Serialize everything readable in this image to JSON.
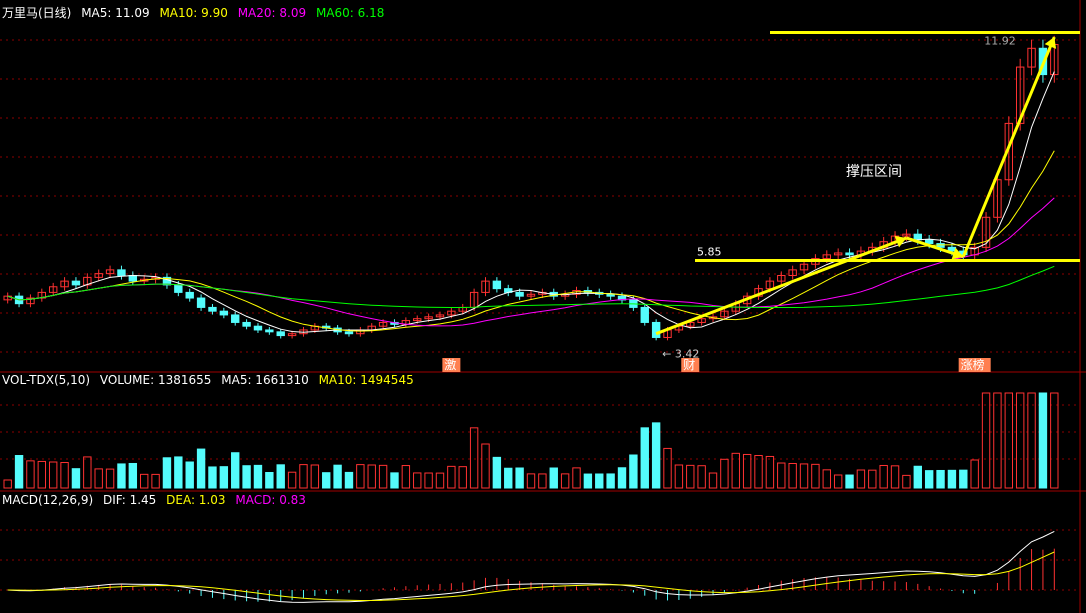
{
  "header": {
    "title": "万里马(日线)",
    "ma_labels": [
      {
        "label": "MA5: 11.09",
        "color": "#ffffff"
      },
      {
        "label": "MA10: 9.90",
        "color": "#ffff00"
      },
      {
        "label": "MA20: 8.09",
        "color": "#ff00ff"
      },
      {
        "label": "MA60: 6.18",
        "color": "#00ff00"
      }
    ]
  },
  "volume_header": {
    "title": "VOL-TDX(5,10)",
    "labels": [
      {
        "label": "VOLUME: 1381655",
        "color": "#ffffff"
      },
      {
        "label": "MA5: 1661310",
        "color": "#ffffff"
      },
      {
        "label": "MA10: 1494545",
        "color": "#ffff00"
      }
    ]
  },
  "macd_header": {
    "title": "MACD(12,26,9)",
    "labels": [
      {
        "label": "DIF: 1.45",
        "color": "#ffffff"
      },
      {
        "label": "DEA: 1.03",
        "color": "#ffff00"
      },
      {
        "label": "MACD: 0.83",
        "color": "#ff00ff"
      }
    ]
  },
  "annotations": {
    "high_label": "11.92",
    "level_label": "5.85",
    "low_label": "3.42",
    "zone_label": "撑压区间",
    "markers": [
      "激",
      "财",
      "涨榜"
    ]
  },
  "colors": {
    "up": "#ff3232",
    "down": "#54fcfc",
    "ma5": "#ffffff",
    "ma10": "#ffff00",
    "ma20": "#ff00ff",
    "ma60": "#00ff00",
    "drawing": "#ffff00",
    "grid": "#8b0000",
    "marker_bg": "#ff7f50"
  },
  "chart_data": {
    "type": "candlestick",
    "price_levels": {
      "high": 11.92,
      "low": 3.42,
      "horizontal_line": 5.85
    },
    "closes": [
      4.9,
      4.7,
      4.85,
      5.0,
      5.15,
      5.3,
      5.2,
      5.4,
      5.5,
      5.6,
      5.45,
      5.3,
      5.35,
      5.4,
      5.2,
      5.0,
      4.85,
      4.6,
      4.5,
      4.4,
      4.2,
      4.1,
      4.0,
      3.95,
      3.85,
      3.9,
      4.0,
      4.1,
      4.05,
      3.95,
      3.9,
      4.0,
      4.1,
      4.2,
      4.15,
      4.25,
      4.3,
      4.35,
      4.4,
      4.5,
      4.6,
      5.0,
      5.3,
      5.1,
      5.0,
      4.9,
      4.95,
      5.0,
      4.9,
      4.95,
      5.05,
      5.0,
      4.95,
      4.9,
      4.8,
      4.6,
      4.2,
      3.8,
      4.0,
      4.1,
      4.2,
      4.3,
      4.35,
      4.5,
      4.7,
      4.9,
      5.1,
      5.3,
      5.45,
      5.6,
      5.75,
      5.9,
      6.0,
      6.05,
      6.0,
      6.1,
      6.2,
      6.35,
      6.5,
      6.55,
      6.4,
      6.3,
      6.2,
      6.1,
      6.0,
      6.2,
      7.0,
      8.0,
      9.5,
      11.0,
      11.5,
      10.8,
      11.6
    ],
    "markers": [
      {
        "label": "激",
        "index": 39
      },
      {
        "label": "财",
        "index": 60
      },
      {
        "label": "涨榜",
        "index": 85
      }
    ],
    "volume_header_values": {
      "VOLUME": 1381655,
      "MA5": 1661310,
      "MA10": 1494545
    },
    "macd_header_values": {
      "DIF": 1.45,
      "DEA": 1.03,
      "MACD": 0.83
    },
    "moving_average_last": {
      "MA5": 11.09,
      "MA10": 9.9,
      "MA20": 8.09,
      "MA60": 6.18
    }
  }
}
